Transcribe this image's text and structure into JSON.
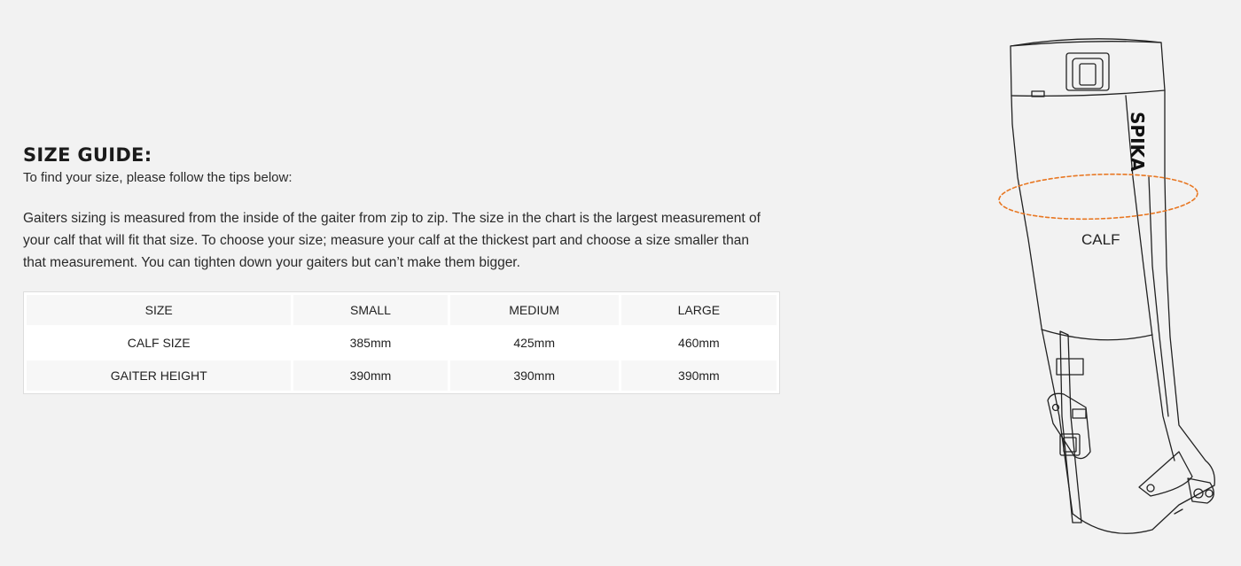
{
  "size_guide": {
    "title": "SIZE GUIDE:",
    "intro": "To find your size, please follow the tips below:",
    "description": "Gaiters sizing is measured from the inside of the gaiter from zip to zip. The size in the chart is the largest measurement of your calf that will fit that size. To choose your size; measure your calf at the thickest part and choose a size smaller than that measurement. You can tighten down your gaiters but can’t make them bigger.",
    "table": {
      "headers": [
        "SIZE",
        "SMALL",
        "MEDIUM",
        "LARGE"
      ],
      "rows": [
        [
          "CALF SIZE",
          "385mm",
          "425mm",
          "460mm"
        ],
        [
          "GAITER HEIGHT",
          "390mm",
          "390mm",
          "390mm"
        ]
      ]
    }
  },
  "illustration": {
    "brand_label": "SPIKA",
    "calf_label": "CALF",
    "accent_color": "#e87722"
  }
}
